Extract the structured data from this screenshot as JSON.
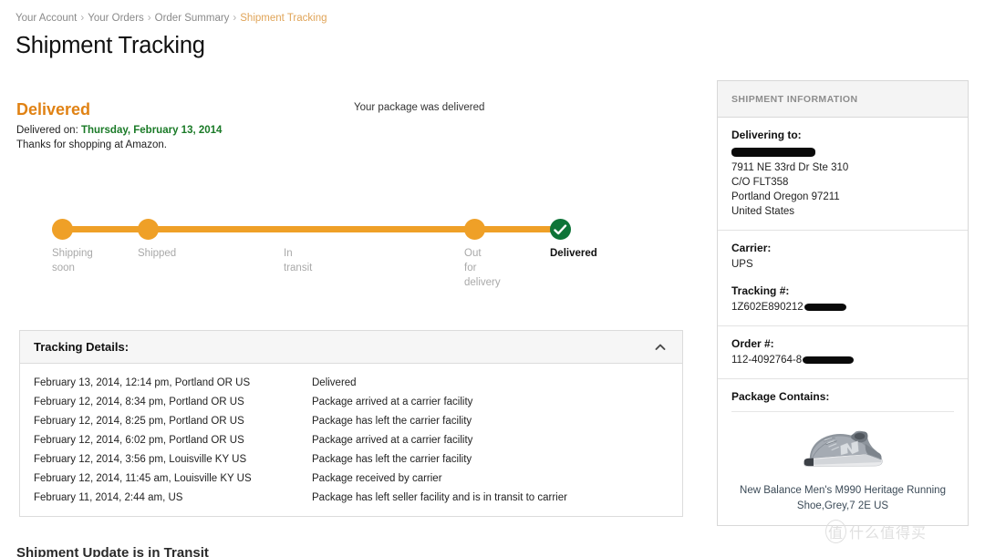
{
  "breadcrumb": {
    "items": [
      {
        "label": "Your Account",
        "current": false
      },
      {
        "label": "Your Orders",
        "current": false
      },
      {
        "label": "Order Summary",
        "current": false
      },
      {
        "label": "Shipment Tracking",
        "current": true
      }
    ],
    "separator": "›"
  },
  "page_title": "Shipment Tracking",
  "status": {
    "headline": "Delivered",
    "note": "Your package was delivered",
    "delivered_on_label": "Delivered on:",
    "delivered_on_date": "Thursday, February 13, 2014",
    "thanks": "Thanks for shopping at Amazon."
  },
  "tracker": {
    "steps": [
      {
        "label": "Shipping\nsoon",
        "state": "complete",
        "dot": true
      },
      {
        "label": "Shipped",
        "state": "complete",
        "dot": true
      },
      {
        "label": "In\ntransit",
        "state": "complete",
        "dot": false
      },
      {
        "label": "Out\nfor\ndelivery",
        "state": "complete",
        "dot": true
      },
      {
        "label": "Delivered",
        "state": "current",
        "dot": true
      }
    ],
    "colors": {
      "bar": "#efa027",
      "dot": "#efa027",
      "delivered": "#0e7438"
    }
  },
  "tracking_details": {
    "title": "Tracking Details:",
    "collapse_icon": "chevron-up-icon",
    "rows": [
      {
        "when": "February 13, 2014, 12:14 pm, Portland OR US",
        "what": "Delivered"
      },
      {
        "when": "February 12, 2014, 8:34 pm, Portland OR US",
        "what": "Package arrived at a carrier facility"
      },
      {
        "when": "February 12, 2014, 8:25 pm, Portland OR US",
        "what": "Package has left the carrier facility"
      },
      {
        "when": "February 12, 2014, 6:02 pm, Portland OR US",
        "what": "Package arrived at a carrier facility"
      },
      {
        "when": "February 12, 2014, 3:56 pm, Louisville KY US",
        "what": "Package has left the carrier facility"
      },
      {
        "when": "February 12, 2014, 11:45 am, Louisville KY US",
        "what": "Package received by carrier"
      },
      {
        "when": "February 11, 2014, 2:44 am, US",
        "what": "Package has left seller facility and is in transit to carrier"
      }
    ]
  },
  "cutoff_heading": "Shipment Update is in Transit",
  "sidebar": {
    "header": "SHIPMENT INFORMATION",
    "delivering_to": {
      "label": "Delivering to:",
      "recipient_redacted": true,
      "lines": [
        "7911 NE 33rd Dr Ste 310",
        "C/O FLT358",
        "Portland Oregon 97211",
        "United States"
      ]
    },
    "carrier": {
      "label": "Carrier:",
      "value": "UPS"
    },
    "tracking": {
      "label": "Tracking #:",
      "value_prefix": "1Z602E890212",
      "redacted": true
    },
    "order": {
      "label": "Order #:",
      "value_prefix": "112-4092764-8",
      "redacted": true
    },
    "package": {
      "label": "Package Contains:",
      "product_image": "running-shoe-image",
      "product_title": "New Balance Men's M990 Heritage Running Shoe,Grey,7 2E US"
    }
  },
  "watermark": {
    "ring": "值",
    "text": "什么值得买"
  }
}
